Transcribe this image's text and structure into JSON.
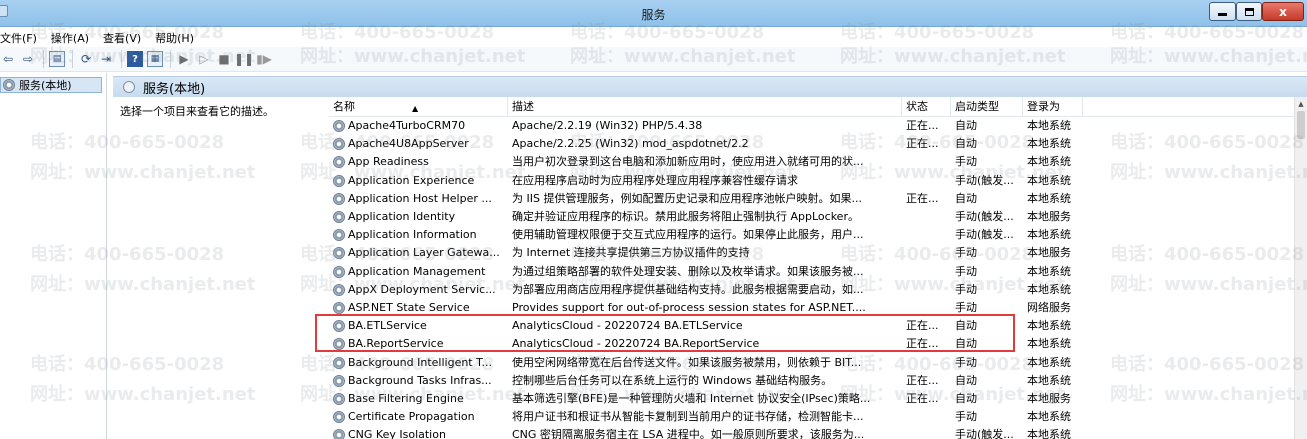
{
  "window": {
    "title": "服务"
  },
  "menu": [
    "文件(F)",
    "操作(A)",
    "查看(V)",
    "帮助(H)"
  ],
  "tree": {
    "selected_label": "服务(本地)"
  },
  "pane": {
    "title": "服务(本地)",
    "hint": "选择一个项目来查看它的描述。"
  },
  "table": {
    "columns": {
      "name": "名称",
      "desc": "描述",
      "status": "状态",
      "start": "启动类型",
      "logon": "登录为"
    },
    "rows": [
      {
        "name": "Apache4TurboCRM70",
        "desc": "Apache/2.2.19 (Win32) PHP/5.4.38",
        "status": "正在...",
        "start": "自动",
        "logon": "本地系统"
      },
      {
        "name": "Apache4U8AppServer",
        "desc": "Apache/2.2.25 (Win32) mod_aspdotnet/2.2",
        "status": "正在...",
        "start": "自动",
        "logon": "本地系统"
      },
      {
        "name": "App Readiness",
        "desc": "当用户初次登录到这台电脑和添加新应用时，使应用进入就绪可用的状...",
        "status": "",
        "start": "手动",
        "logon": "本地系统"
      },
      {
        "name": "Application Experience",
        "desc": "在应用程序启动时为应用程序处理应用程序兼容性缓存请求",
        "status": "",
        "start": "手动(触发...",
        "logon": "本地系统"
      },
      {
        "name": "Application Host Helper ...",
        "desc": "为 IIS 提供管理服务，例如配置历史记录和应用程序池帐户映射。如果...",
        "status": "正在...",
        "start": "自动",
        "logon": "本地系统"
      },
      {
        "name": "Application Identity",
        "desc": "确定并验证应用程序的标识。禁用此服务将阻止强制执行 AppLocker。",
        "status": "",
        "start": "手动(触发...",
        "logon": "本地服务"
      },
      {
        "name": "Application Information",
        "desc": "使用辅助管理权限便于交互式应用程序的运行。如果停止此服务，用户...",
        "status": "",
        "start": "手动(触发...",
        "logon": "本地系统"
      },
      {
        "name": "Application Layer Gatewa...",
        "desc": "为 Internet 连接共享提供第三方协议插件的支持",
        "status": "",
        "start": "手动",
        "logon": "本地服务"
      },
      {
        "name": "Application Management",
        "desc": "为通过组策略部署的软件处理安装、删除以及枚举请求。如果该服务被...",
        "status": "",
        "start": "手动",
        "logon": "本地系统"
      },
      {
        "name": "AppX Deployment Servic...",
        "desc": "为部署应用商店应用程序提供基础结构支持。此服务根据需要启动，如...",
        "status": "",
        "start": "手动",
        "logon": "本地系统"
      },
      {
        "name": "ASP.NET State Service",
        "desc": "Provides support for out-of-process session states for ASP.NET....",
        "status": "",
        "start": "手动",
        "logon": "网络服务"
      },
      {
        "name": "BA.ETLService",
        "desc": "AnalyticsCloud - 20220724 BA.ETLService",
        "status": "正在...",
        "start": "自动",
        "logon": "本地系统"
      },
      {
        "name": "BA.ReportService",
        "desc": "AnalyticsCloud - 20220724 BA.ReportService",
        "status": "正在...",
        "start": "自动",
        "logon": "本地系统"
      },
      {
        "name": "Background Intelligent T...",
        "desc": "使用空闲网络带宽在后台传送文件。如果该服务被禁用，则依赖于 BIT...",
        "status": "",
        "start": "手动",
        "logon": "本地系统"
      },
      {
        "name": "Background Tasks Infras...",
        "desc": "控制哪些后台任务可以在系统上运行的 Windows 基础结构服务。",
        "status": "正在...",
        "start": "自动",
        "logon": "本地系统"
      },
      {
        "name": "Base Filtering Engine",
        "desc": "基本筛选引擎(BFE)是一种管理防火墙和 Internet 协议安全(IPsec)策略...",
        "status": "正在...",
        "start": "自动",
        "logon": "本地服务"
      },
      {
        "name": "Certificate Propagation",
        "desc": "将用户证书和根证书从智能卡复制到当前用户的证书存储，检测智能卡...",
        "status": "",
        "start": "手动",
        "logon": "本地系统"
      },
      {
        "name": "CNG Key Isolation",
        "desc": "CNG 密钥隔离服务宿主在 LSA 进程中。如一般原则所要求，该服务为...",
        "status": "",
        "start": "手动(触发...",
        "logon": "本地系统"
      }
    ]
  },
  "watermark": {
    "phone": "电话：400-665-0028",
    "site": "网址：www.chanjet.net"
  },
  "colors": {
    "highlight": "#e23b3b",
    "titlebar": "#a9d0f0"
  }
}
